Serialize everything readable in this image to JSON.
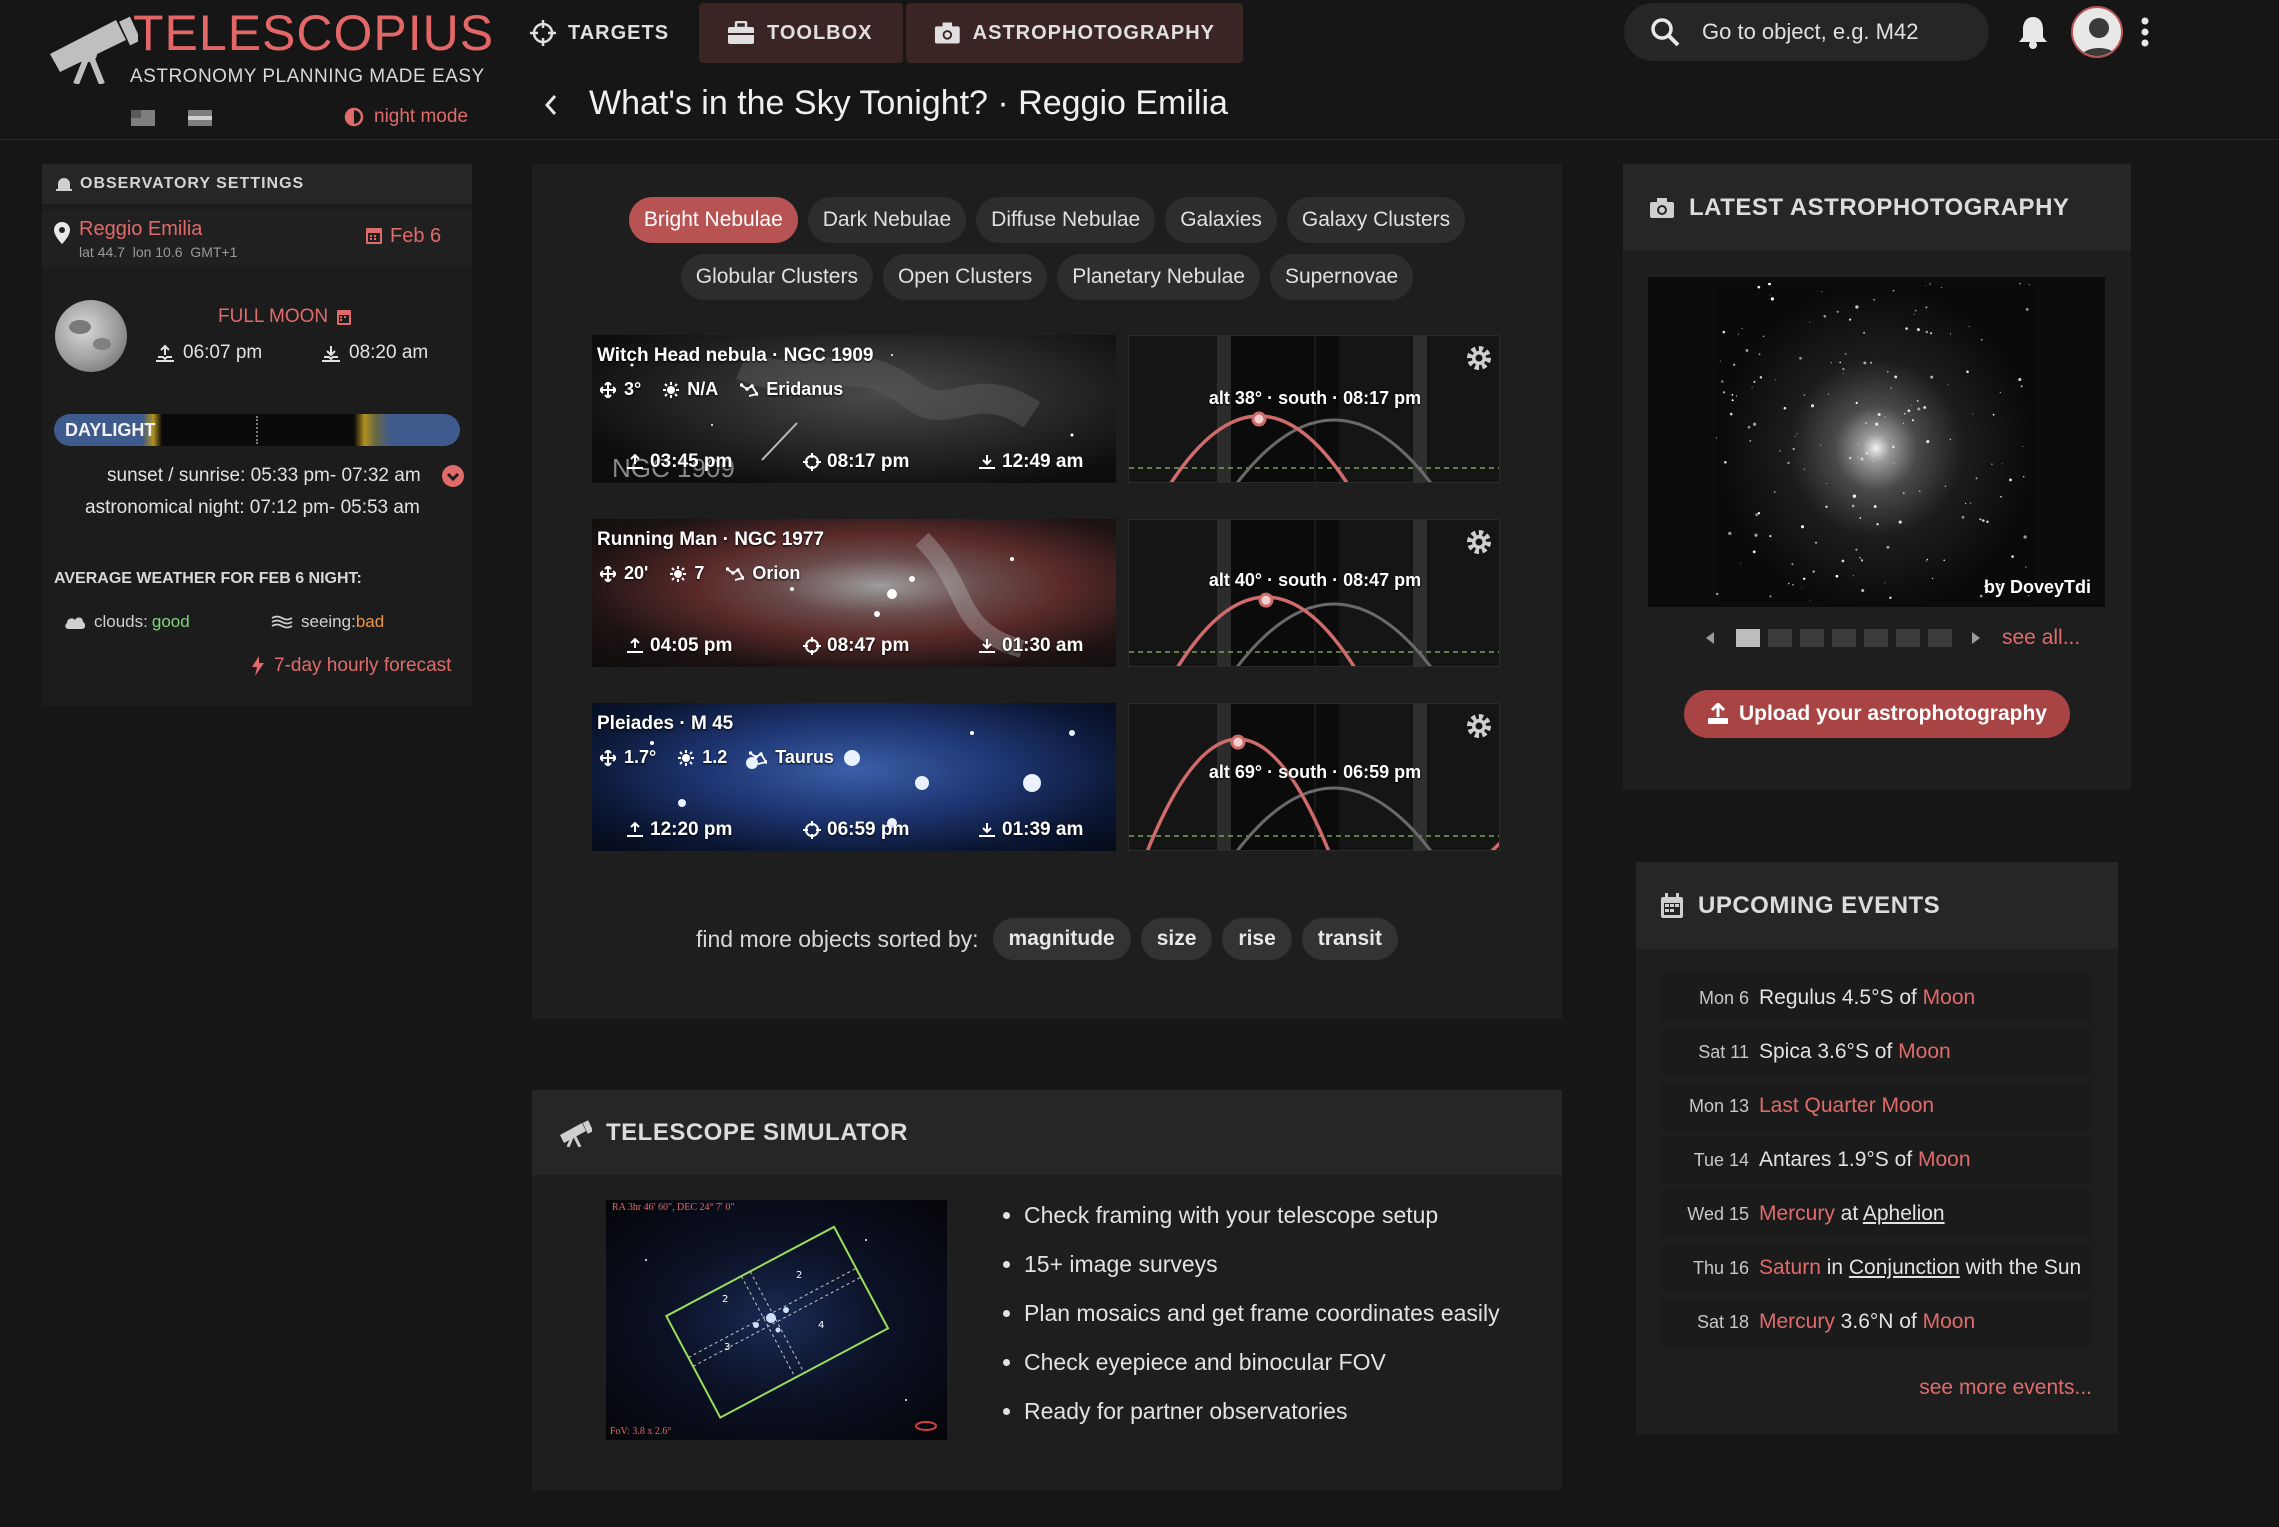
{
  "header": {
    "logo_title": "TELESCOPIUS",
    "logo_subtitle": "ASTRONOMY PLANNING MADE EASY",
    "night_mode": "night mode",
    "nav": [
      {
        "label": "TARGETS"
      },
      {
        "label": "TOOLBOX"
      },
      {
        "label": "ASTROPHOTOGRAPHY"
      }
    ],
    "search_placeholder": "Go to object, e.g. M42"
  },
  "page_title": "What's in the Sky Tonight? · Reggio Emilia",
  "observatory": {
    "heading": "OBSERVATORY SETTINGS",
    "location": "Reggio Emilia",
    "coords": "lat 44.7  lon 10.6  GMT+1",
    "date": "Feb 6",
    "moon_phase": "FULL MOON",
    "moonrise": "06:07 pm",
    "moonset": "08:20 am",
    "daylight_label": "DAYLIGHT",
    "sunset_label": "sunset / sunrise: 05:33 pm- 07:32 am",
    "astro_night_label": "astronomical night: 07:12 pm- 05:53 am",
    "weather_heading": "AVERAGE WEATHER FOR FEB 6 NIGHT:",
    "clouds_label": "clouds:",
    "clouds_value": "good",
    "seeing_label": "seeing:",
    "seeing_value": "bad",
    "forecast_link": "7-day hourly forecast"
  },
  "filters": {
    "row1": [
      "Bright Nebulae",
      "Dark Nebulae",
      "Diffuse Nebulae",
      "Galaxies",
      "Galaxy Clusters"
    ],
    "row2": [
      "Globular Clusters",
      "Open Clusters",
      "Planetary Nebulae",
      "Supernovae"
    ],
    "active": "Bright Nebulae"
  },
  "objects": [
    {
      "name": "Witch Head nebula · NGC 1909",
      "size": "3°",
      "magnitude": "N/A",
      "constellation": "Eridanus",
      "rise": "03:45 pm",
      "transit": "08:17 pm",
      "set": "12:49 am",
      "watermark": "NGC 1909",
      "chart_label": "alt 38° · south · 08:17 pm",
      "max_alt_deg": 38
    },
    {
      "name": "Running Man · NGC 1977",
      "size": "20'",
      "magnitude": "7",
      "constellation": "Orion",
      "rise": "04:05 pm",
      "transit": "08:47 pm",
      "set": "01:30 am",
      "chart_label": "alt 40° · south · 08:47 pm",
      "max_alt_deg": 40
    },
    {
      "name": "Pleiades · M 45",
      "size": "1.7°",
      "magnitude": "1.2",
      "constellation": "Taurus",
      "rise": "12:20 pm",
      "transit": "06:59 pm",
      "set": "01:39 am",
      "chart_label": "alt 69° · south · 06:59 pm",
      "max_alt_deg": 69
    }
  ],
  "sort": {
    "label": "find more objects sorted by:",
    "options": [
      "magnitude",
      "size",
      "rise",
      "transit"
    ]
  },
  "simulator": {
    "heading": "TELESCOPE SIMULATOR",
    "image_caption_top": "RA 3hr 46' 60\", DEC 24° 7' 0\"",
    "image_caption_bottom": "FoV: 3.8 x 2.6°",
    "bullets": [
      "Check framing with your telescope setup",
      "15+ image surveys",
      "Plan mosaics and get frame coordinates easily",
      "Check eyepiece and binocular FOV",
      "Ready for partner observatories"
    ]
  },
  "astrophotography": {
    "heading": "LATEST ASTROPHOTOGRAPHY",
    "credit": "by DoveyTdi",
    "see_all": "see all...",
    "upload_button": "Upload your astrophotography"
  },
  "events": {
    "heading": "UPCOMING EVENTS",
    "items": [
      {
        "date": "Mon 6",
        "parts": [
          [
            "Regulus 4.5°S of ",
            "plain"
          ],
          [
            "Moon",
            "red"
          ]
        ]
      },
      {
        "date": "Sat 11",
        "parts": [
          [
            "Spica 3.6°S of ",
            "plain"
          ],
          [
            "Moon",
            "red"
          ]
        ]
      },
      {
        "date": "Mon 13",
        "parts": [
          [
            "Last Quarter Moon",
            "red"
          ]
        ]
      },
      {
        "date": "Tue 14",
        "parts": [
          [
            "Antares 1.9°S of ",
            "plain"
          ],
          [
            "Moon",
            "red"
          ]
        ]
      },
      {
        "date": "Wed 15",
        "parts": [
          [
            "Mercury",
            "red"
          ],
          [
            " at ",
            "plain"
          ],
          [
            "Aphelion",
            "u"
          ]
        ]
      },
      {
        "date": "Thu 16",
        "parts": [
          [
            "Saturn",
            "red"
          ],
          [
            " in ",
            "plain"
          ],
          [
            "Conjunction",
            "u"
          ],
          [
            " with the Sun",
            "plain"
          ]
        ]
      },
      {
        "date": "Sat 18",
        "parts": [
          [
            "Mercury",
            "red"
          ],
          [
            " 3.6°N of ",
            "plain"
          ],
          [
            "Moon",
            "red"
          ]
        ]
      }
    ],
    "see_more": "see more events..."
  },
  "colors": {
    "accent": "#e06b6b",
    "active_chip": "#b85353",
    "good": "#7fd67f",
    "bad": "#e89a4a",
    "daylight": "#3f5a8c"
  }
}
